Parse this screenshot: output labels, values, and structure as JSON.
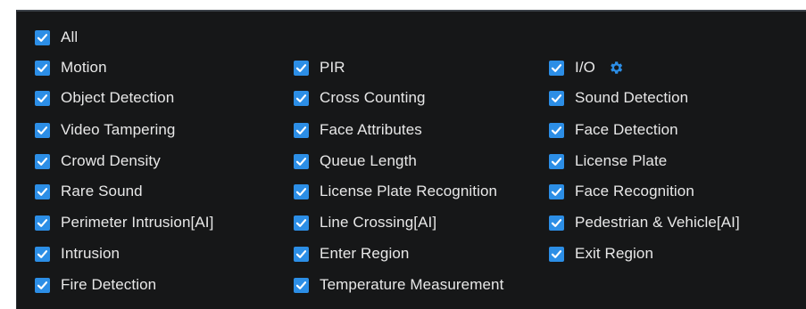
{
  "accent_color": "#2c8ee6",
  "top_strip_text": "",
  "all_option": {
    "label": "All",
    "checked": true
  },
  "columns": [
    [
      {
        "label": "Motion",
        "checked": true
      },
      {
        "label": "Object Detection",
        "checked": true
      },
      {
        "label": "Video Tampering",
        "checked": true
      },
      {
        "label": "Crowd Density",
        "checked": true
      },
      {
        "label": "Rare Sound",
        "checked": true
      },
      {
        "label": "Perimeter Intrusion[AI]",
        "checked": true
      },
      {
        "label": "Intrusion",
        "checked": true
      },
      {
        "label": "Fire Detection",
        "checked": true
      }
    ],
    [
      {
        "label": "PIR",
        "checked": true
      },
      {
        "label": "Cross Counting",
        "checked": true
      },
      {
        "label": "Face Attributes",
        "checked": true
      },
      {
        "label": "Queue Length",
        "checked": true
      },
      {
        "label": "License Plate Recognition",
        "checked": true
      },
      {
        "label": "Line Crossing[AI]",
        "checked": true
      },
      {
        "label": "Enter Region",
        "checked": true
      },
      {
        "label": "Temperature Measurement",
        "checked": true
      }
    ],
    [
      {
        "label": "I/O",
        "checked": true,
        "icon": "gear-icon"
      },
      {
        "label": "Sound Detection",
        "checked": true
      },
      {
        "label": "Face Detection",
        "checked": true
      },
      {
        "label": "License Plate",
        "checked": true
      },
      {
        "label": "Face Recognition",
        "checked": true
      },
      {
        "label": "Pedestrian & Vehicle[AI]",
        "checked": true
      },
      {
        "label": "Exit Region",
        "checked": true
      }
    ]
  ]
}
